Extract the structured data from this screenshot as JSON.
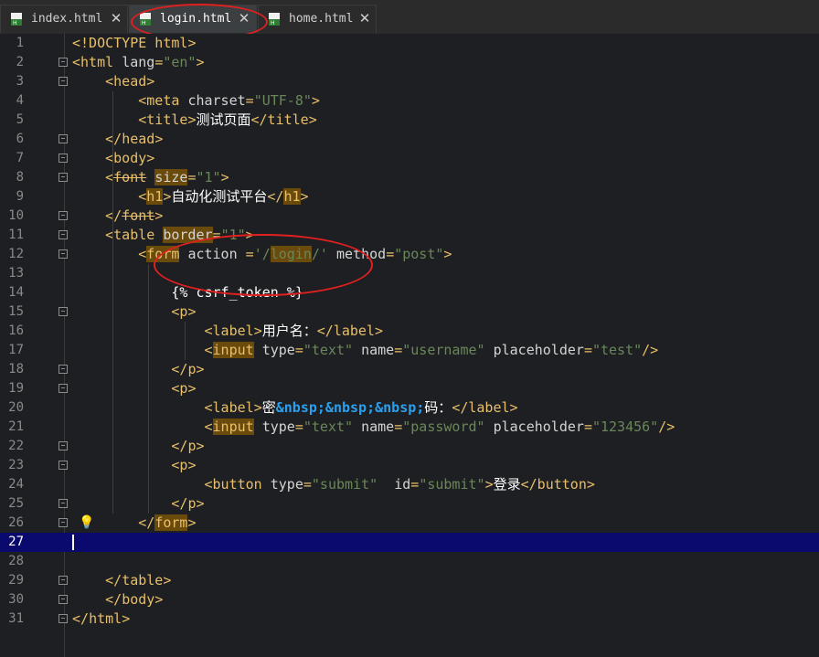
{
  "tabs": [
    {
      "label": "index.html",
      "active": false,
      "close": "✕",
      "icon": "html-file-icon"
    },
    {
      "label": "login.html",
      "active": true,
      "close": "✕",
      "icon": "html-file-icon"
    },
    {
      "label": "home.html",
      "active": false,
      "close": "✕",
      "icon": "html-file-icon"
    }
  ],
  "editor": {
    "current_line": 27,
    "lines": [
      {
        "n": "1",
        "segs": [
          [
            "p",
            "<"
          ],
          [
            "t",
            "!DOCTYPE html"
          ],
          [
            "p",
            ">"
          ]
        ]
      },
      {
        "n": "2",
        "segs": [
          [
            "p",
            "<"
          ],
          [
            "t",
            "html "
          ],
          [
            "a",
            "lang"
          ],
          [
            "p",
            "="
          ],
          [
            "s",
            "\"en\""
          ],
          [
            "p",
            ">"
          ]
        ]
      },
      {
        "n": "3",
        "segs": [
          [
            "x",
            "    "
          ],
          [
            "p",
            "<"
          ],
          [
            "t",
            "head"
          ],
          [
            "p",
            ">"
          ]
        ]
      },
      {
        "n": "4",
        "segs": [
          [
            "x",
            "        "
          ],
          [
            "p",
            "<"
          ],
          [
            "t",
            "meta "
          ],
          [
            "a",
            "charset"
          ],
          [
            "p",
            "="
          ],
          [
            "s",
            "\"UTF-8\""
          ],
          [
            "p",
            ">"
          ]
        ]
      },
      {
        "n": "5",
        "segs": [
          [
            "x",
            "        "
          ],
          [
            "p",
            "<"
          ],
          [
            "t",
            "title"
          ],
          [
            "p",
            ">"
          ],
          [
            "x",
            "测试页面"
          ],
          [
            "p",
            "</"
          ],
          [
            "t",
            "title"
          ],
          [
            "p",
            ">"
          ]
        ]
      },
      {
        "n": "6",
        "segs": [
          [
            "x",
            "    "
          ],
          [
            "p",
            "</"
          ],
          [
            "t",
            "head"
          ],
          [
            "p",
            ">"
          ]
        ]
      },
      {
        "n": "7",
        "segs": [
          [
            "x",
            "    "
          ],
          [
            "p",
            "<"
          ],
          [
            "t",
            "body"
          ],
          [
            "p",
            ">"
          ]
        ]
      },
      {
        "n": "8",
        "segs": [
          [
            "x",
            "    "
          ],
          [
            "p",
            "<"
          ],
          [
            "ts",
            "font"
          ],
          [
            "x",
            " "
          ],
          [
            "ah",
            "size"
          ],
          [
            "p",
            "="
          ],
          [
            "s",
            "\"1\""
          ],
          [
            "p",
            ">"
          ]
        ]
      },
      {
        "n": "9",
        "segs": [
          [
            "x",
            "        "
          ],
          [
            "p",
            "<"
          ],
          [
            "th",
            "h1"
          ],
          [
            "p",
            ">"
          ],
          [
            "x",
            "自动化测试平台"
          ],
          [
            "p",
            "</"
          ],
          [
            "th",
            "h1"
          ],
          [
            "p",
            ">"
          ]
        ]
      },
      {
        "n": "10",
        "segs": [
          [
            "x",
            "    "
          ],
          [
            "p",
            "</"
          ],
          [
            "ts",
            "font"
          ],
          [
            "p",
            ">"
          ]
        ]
      },
      {
        "n": "11",
        "segs": [
          [
            "x",
            "    "
          ],
          [
            "p",
            "<"
          ],
          [
            "t",
            "table "
          ],
          [
            "ah",
            "border"
          ],
          [
            "p",
            "="
          ],
          [
            "s",
            "\"1\""
          ],
          [
            "p",
            ">"
          ]
        ]
      },
      {
        "n": "12",
        "segs": [
          [
            "x",
            "        "
          ],
          [
            "p",
            "<"
          ],
          [
            "th",
            "form"
          ],
          [
            "x",
            " "
          ],
          [
            "a",
            "action "
          ],
          [
            "p",
            "="
          ],
          [
            "s",
            "'/"
          ],
          [
            "sh",
            "login"
          ],
          [
            "s",
            "/'"
          ],
          [
            "x",
            " "
          ],
          [
            "a",
            "method"
          ],
          [
            "p",
            "="
          ],
          [
            "s",
            "\"post\""
          ],
          [
            "p",
            ">"
          ]
        ]
      },
      {
        "n": "13",
        "segs": []
      },
      {
        "n": "14",
        "segs": [
          [
            "x",
            "            {% csrf_token %}"
          ]
        ]
      },
      {
        "n": "15",
        "segs": [
          [
            "x",
            "            "
          ],
          [
            "p",
            "<"
          ],
          [
            "t",
            "p"
          ],
          [
            "p",
            ">"
          ]
        ]
      },
      {
        "n": "16",
        "segs": [
          [
            "x",
            "                "
          ],
          [
            "p",
            "<"
          ],
          [
            "t",
            "label"
          ],
          [
            "p",
            ">"
          ],
          [
            "x",
            "用户名："
          ],
          [
            "p",
            "</"
          ],
          [
            "t",
            "label"
          ],
          [
            "p",
            ">"
          ]
        ]
      },
      {
        "n": "17",
        "segs": [
          [
            "x",
            "                "
          ],
          [
            "p",
            "<"
          ],
          [
            "th",
            "input"
          ],
          [
            "x",
            " "
          ],
          [
            "a",
            "type"
          ],
          [
            "p",
            "="
          ],
          [
            "s",
            "\"text\""
          ],
          [
            "x",
            " "
          ],
          [
            "a",
            "name"
          ],
          [
            "p",
            "="
          ],
          [
            "s",
            "\"username\""
          ],
          [
            "x",
            " "
          ],
          [
            "a",
            "placeholder"
          ],
          [
            "p",
            "="
          ],
          [
            "s",
            "\"test\""
          ],
          [
            "p",
            "/>"
          ]
        ]
      },
      {
        "n": "18",
        "segs": [
          [
            "x",
            "            "
          ],
          [
            "p",
            "</"
          ],
          [
            "t",
            "p"
          ],
          [
            "p",
            ">"
          ]
        ]
      },
      {
        "n": "19",
        "segs": [
          [
            "x",
            "            "
          ],
          [
            "p",
            "<"
          ],
          [
            "t",
            "p"
          ],
          [
            "p",
            ">"
          ]
        ]
      },
      {
        "n": "20",
        "segs": [
          [
            "x",
            "                "
          ],
          [
            "p",
            "<"
          ],
          [
            "t",
            "label"
          ],
          [
            "p",
            ">"
          ],
          [
            "x",
            "密"
          ],
          [
            "e",
            "&nbsp;&nbsp;&nbsp;"
          ],
          [
            "x",
            "码："
          ],
          [
            "p",
            "</"
          ],
          [
            "t",
            "label"
          ],
          [
            "p",
            ">"
          ]
        ]
      },
      {
        "n": "21",
        "segs": [
          [
            "x",
            "                "
          ],
          [
            "p",
            "<"
          ],
          [
            "th",
            "input"
          ],
          [
            "x",
            " "
          ],
          [
            "a",
            "type"
          ],
          [
            "p",
            "="
          ],
          [
            "s",
            "\"text\""
          ],
          [
            "x",
            " "
          ],
          [
            "a",
            "name"
          ],
          [
            "p",
            "="
          ],
          [
            "s",
            "\"password\""
          ],
          [
            "x",
            " "
          ],
          [
            "a",
            "placeholder"
          ],
          [
            "p",
            "="
          ],
          [
            "s",
            "\"123456\""
          ],
          [
            "p",
            "/>"
          ]
        ]
      },
      {
        "n": "22",
        "segs": [
          [
            "x",
            "            "
          ],
          [
            "p",
            "</"
          ],
          [
            "t",
            "p"
          ],
          [
            "p",
            ">"
          ]
        ]
      },
      {
        "n": "23",
        "segs": [
          [
            "x",
            "            "
          ],
          [
            "p",
            "<"
          ],
          [
            "t",
            "p"
          ],
          [
            "p",
            ">"
          ]
        ]
      },
      {
        "n": "24",
        "segs": [
          [
            "x",
            "                "
          ],
          [
            "p",
            "<"
          ],
          [
            "t",
            "button "
          ],
          [
            "a",
            "type"
          ],
          [
            "p",
            "="
          ],
          [
            "s",
            "\"submit\""
          ],
          [
            "x",
            "  "
          ],
          [
            "a",
            "id"
          ],
          [
            "p",
            "="
          ],
          [
            "s",
            "\"submit\""
          ],
          [
            "p",
            ">"
          ],
          [
            "x",
            "登录"
          ],
          [
            "p",
            "</"
          ],
          [
            "t",
            "button"
          ],
          [
            "p",
            ">"
          ]
        ]
      },
      {
        "n": "25",
        "segs": [
          [
            "x",
            "            "
          ],
          [
            "p",
            "</"
          ],
          [
            "t",
            "p"
          ],
          [
            "p",
            ">"
          ]
        ]
      },
      {
        "n": "26",
        "segs": [
          [
            "x",
            "        "
          ],
          [
            "p",
            "</"
          ],
          [
            "th",
            "form"
          ],
          [
            "p",
            ">"
          ]
        ]
      },
      {
        "n": "27",
        "segs": []
      },
      {
        "n": "28",
        "segs": []
      },
      {
        "n": "29",
        "segs": [
          [
            "x",
            "    "
          ],
          [
            "p",
            "</"
          ],
          [
            "t",
            "table"
          ],
          [
            "p",
            ">"
          ]
        ]
      },
      {
        "n": "30",
        "segs": [
          [
            "x",
            "    "
          ],
          [
            "p",
            "</"
          ],
          [
            "t",
            "body"
          ],
          [
            "p",
            ">"
          ]
        ]
      },
      {
        "n": "31",
        "segs": [
          [
            "p",
            "</"
          ],
          [
            "t",
            "html"
          ],
          [
            "p",
            ">"
          ]
        ]
      }
    ],
    "fold_lines": [
      2,
      3,
      6,
      7,
      8,
      10,
      11,
      12,
      15,
      18,
      19,
      22,
      23,
      25,
      26,
      29,
      30,
      31
    ],
    "bulb_line": 26,
    "bulb_icon": "lightbulb-icon"
  },
  "colors": {
    "tag": "#e8bf6a",
    "string": "#6a8759",
    "entity": "#2aa0f0",
    "highlight": "#6b4b0c",
    "current_line": "#0a0a6e",
    "annotation": "#e02020"
  }
}
